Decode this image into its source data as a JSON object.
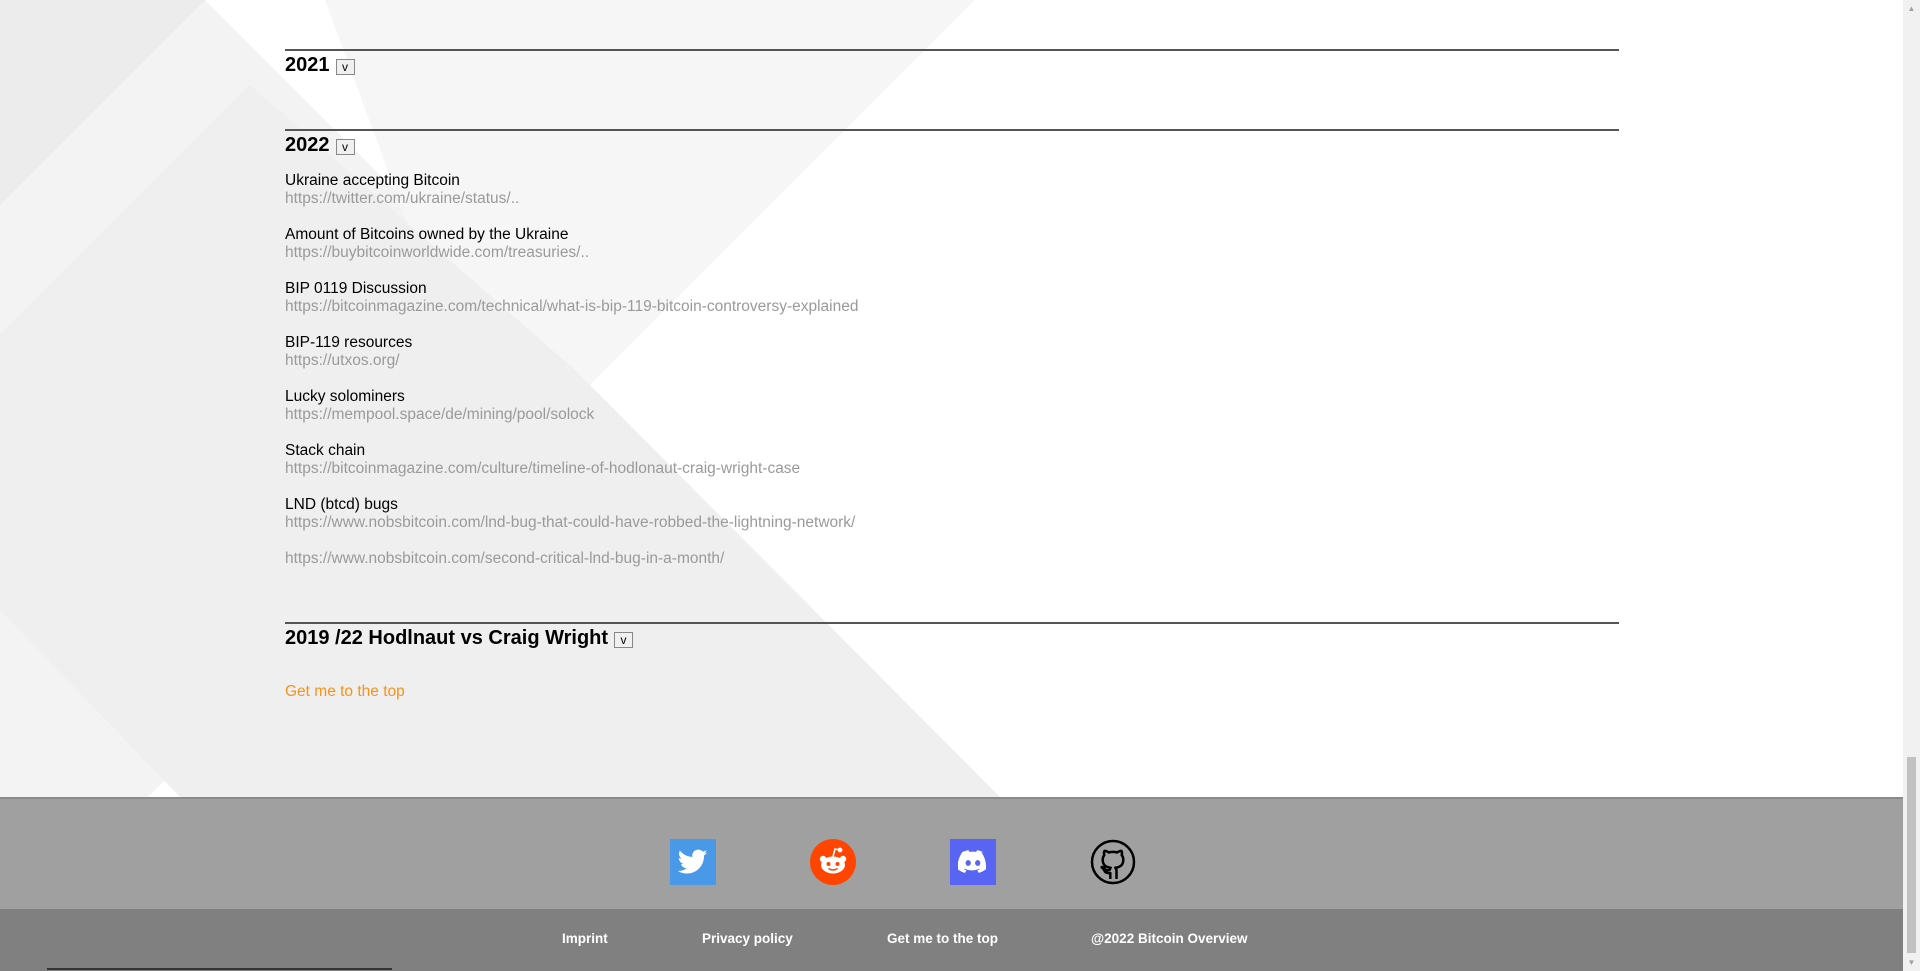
{
  "sections": {
    "y2021": {
      "title": "2021",
      "toggle": "v"
    },
    "y2022": {
      "title": "2022",
      "toggle": "v",
      "entries": [
        {
          "title": "Ukraine accepting Bitcoin",
          "link": "https://twitter.com/ukraine/status/.."
        },
        {
          "title": "Amount of Bitcoins owned by the Ukraine",
          "link": "https://buybitcoinworldwide.com/treasuries/.."
        },
        {
          "title": "BIP 0119 Discussion",
          "link": "https://bitcoinmagazine.com/technical/what-is-bip-119-bitcoin-controversy-explained"
        },
        {
          "title": "BIP-119 resources",
          "link": "https://utxos.org/"
        },
        {
          "title": "Lucky solominers",
          "link": "https://mempool.space/de/mining/pool/solock"
        },
        {
          "title": "Stack chain",
          "link": "https://bitcoinmagazine.com/culture/timeline-of-hodlonaut-craig-wright-case"
        },
        {
          "title": "LND (btcd) bugs",
          "link": "https://www.nobsbitcoin.com/lnd-bug-that-could-have-robbed-the-lightning-network/",
          "link2": "https://www.nobsbitcoin.com/second-critical-lnd-bug-in-a-month/"
        }
      ]
    },
    "hodlnaut": {
      "title": "2019 /22 Hodlnaut vs Craig Wright",
      "toggle": "v"
    }
  },
  "to_top": "Get me to the top",
  "footer": {
    "social_icons": [
      "twitter-icon",
      "reddit-icon",
      "discord-icon",
      "github-icon"
    ],
    "links": {
      "imprint": "Imprint",
      "privacy": "Privacy policy",
      "top": "Get me to the top",
      "copyright": "@2022 Bitcoin Overview"
    }
  },
  "colors": {
    "link_gray": "#9a9a9a",
    "accent_orange": "#f7931a",
    "twitter": "#4a99e9",
    "reddit": "#ff4500",
    "discord": "#5865f2",
    "footer_top": "#a0a0a0",
    "footer_bottom": "#808080"
  }
}
